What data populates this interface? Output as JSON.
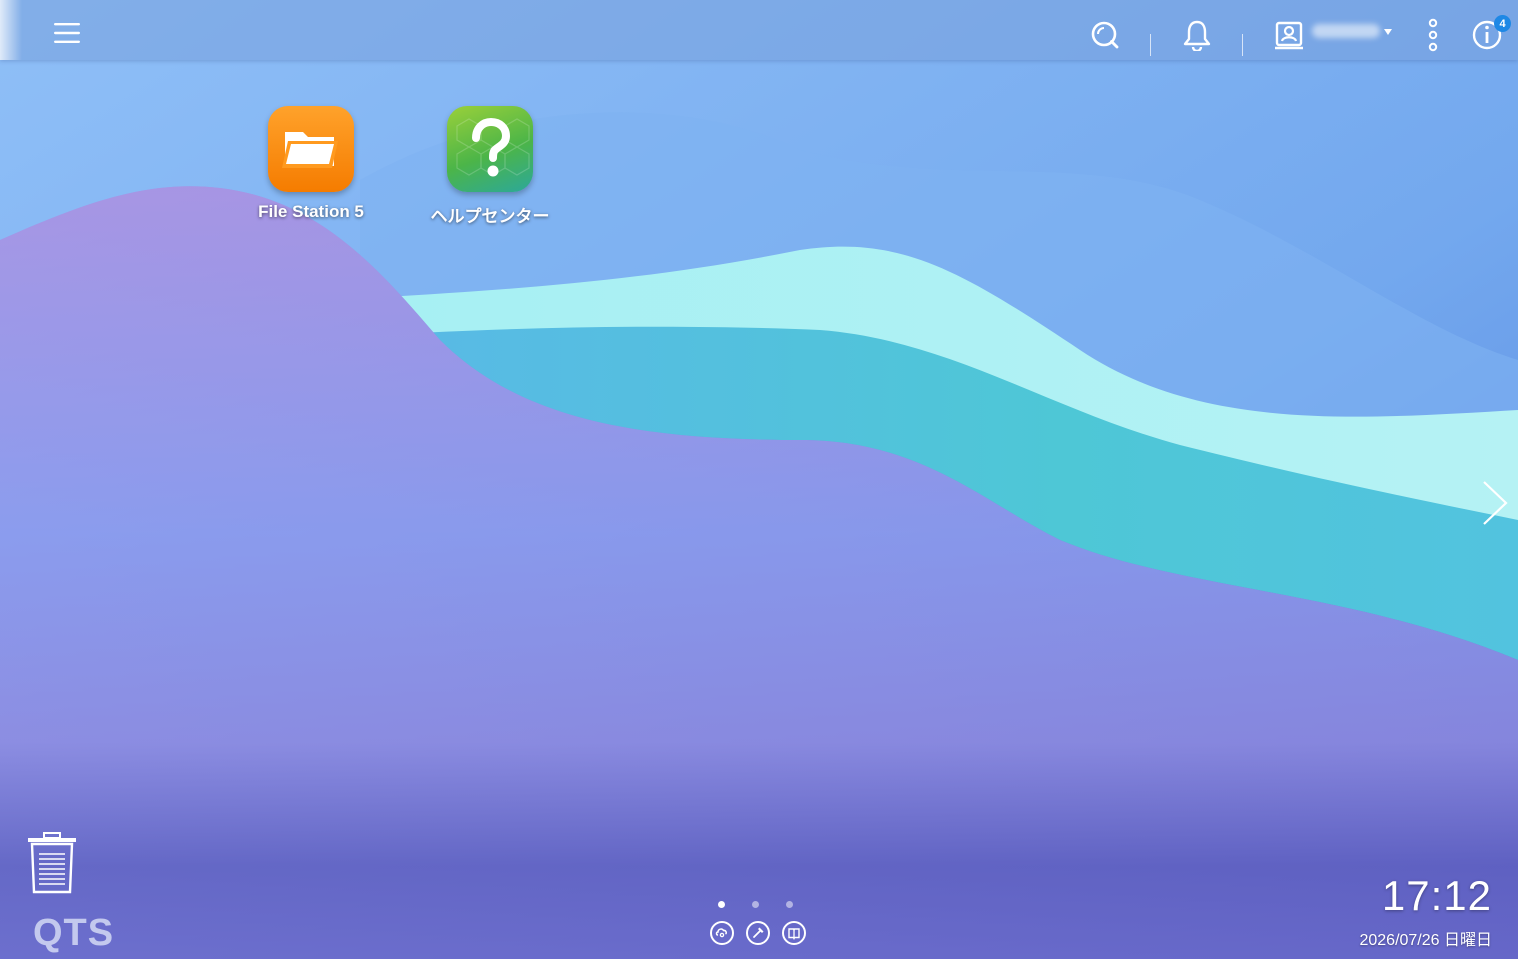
{
  "topbar": {
    "menu_icon": "hamburger-icon",
    "search_icon": "search-icon",
    "notification_icon": "bell-icon",
    "user_icon": "user-icon",
    "more_icon": "more-vertical-icon",
    "info_icon": "info-icon",
    "info_badge": "4"
  },
  "desktop": {
    "apps": [
      {
        "label": "File Station 5",
        "icon": "folder-icon"
      },
      {
        "label": "ヘルプセンター",
        "icon": "help-icon"
      }
    ]
  },
  "trash": {
    "icon": "trash-icon"
  },
  "brand": {
    "logo": "QTS"
  },
  "pager": {
    "total": 3,
    "active": 1
  },
  "dock": {
    "icons": [
      "myqnapcloud-icon",
      "tools-icon",
      "book-icon"
    ]
  },
  "clock": {
    "time": "17:12",
    "date": "2026/07/26 日曜日"
  },
  "colors": {
    "accent": "#1e88e5",
    "folder": "#f57c00",
    "help": "#4cb548"
  }
}
